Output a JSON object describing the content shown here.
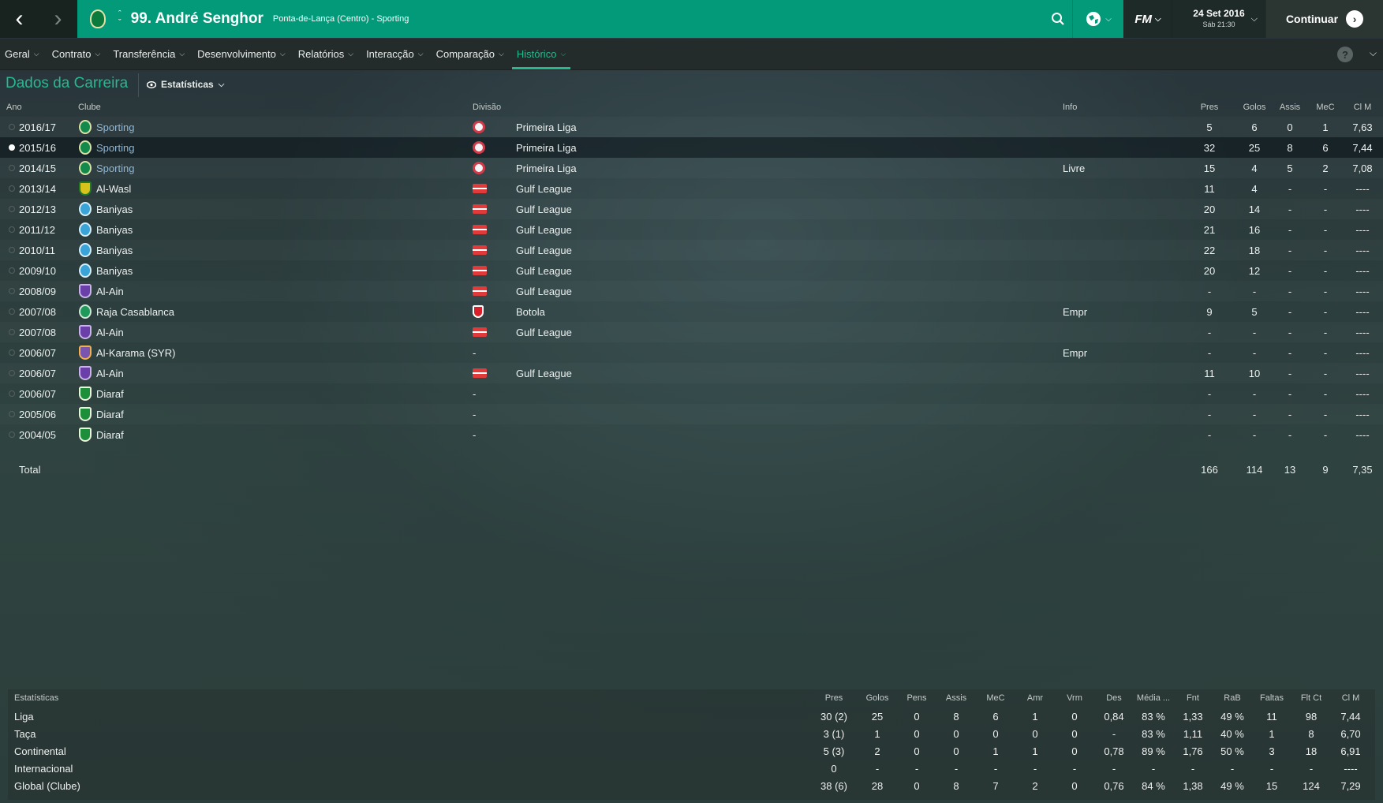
{
  "topbar": {
    "back_icon": "chevron-left-icon",
    "forward_icon": "chevron-right-icon",
    "player_name": "99. André Senghor",
    "player_subtitle": "Ponta-de-Lança (Centro) - Sporting",
    "date": "24 Set 2016",
    "time": "Sáb 21:30",
    "fm_label": "FM",
    "continue_label": "Continuar",
    "accent_color": "#029a79"
  },
  "menu": {
    "items": [
      {
        "label": "Geral"
      },
      {
        "label": "Contrato"
      },
      {
        "label": "Transferência"
      },
      {
        "label": "Desenvolvimento"
      },
      {
        "label": "Relatórios"
      },
      {
        "label": "Interacção"
      },
      {
        "label": "Comparação"
      },
      {
        "label": "Histórico"
      }
    ],
    "active": "Histórico",
    "help_label": "?"
  },
  "section": {
    "title": "Dados da Carreira",
    "view_label": "Estatísticas"
  },
  "career": {
    "headers": {
      "ano": "Ano",
      "clube": "Clube",
      "divisao": "Divisão",
      "info": "Info",
      "pres": "Pres",
      "golos": "Golos",
      "assis": "Assis",
      "mec": "MeC",
      "clm": "Cl M"
    },
    "rows": [
      {
        "ano": "2016/17",
        "clube": "Sporting",
        "divisao": "Primeira Liga",
        "info": "",
        "pres": "5",
        "golos": "6",
        "assis": "0",
        "mec": "1",
        "clm": "7,63"
      },
      {
        "ano": "2015/16",
        "clube": "Sporting",
        "divisao": "Primeira Liga",
        "info": "",
        "pres": "32",
        "golos": "25",
        "assis": "8",
        "mec": "6",
        "clm": "7,44"
      },
      {
        "ano": "2014/15",
        "clube": "Sporting",
        "divisao": "Primeira Liga",
        "info": "Livre",
        "pres": "15",
        "golos": "4",
        "assis": "5",
        "mec": "2",
        "clm": "7,08"
      },
      {
        "ano": "2013/14",
        "clube": "Al-Wasl",
        "divisao": "Gulf League",
        "info": "",
        "pres": "11",
        "golos": "4",
        "assis": "-",
        "mec": "-",
        "clm": "----"
      },
      {
        "ano": "2012/13",
        "clube": "Baniyas",
        "divisao": "Gulf League",
        "info": "",
        "pres": "20",
        "golos": "14",
        "assis": "-",
        "mec": "-",
        "clm": "----"
      },
      {
        "ano": "2011/12",
        "clube": "Baniyas",
        "divisao": "Gulf League",
        "info": "",
        "pres": "21",
        "golos": "16",
        "assis": "-",
        "mec": "-",
        "clm": "----"
      },
      {
        "ano": "2010/11",
        "clube": "Baniyas",
        "divisao": "Gulf League",
        "info": "",
        "pres": "22",
        "golos": "18",
        "assis": "-",
        "mec": "-",
        "clm": "----"
      },
      {
        "ano": "2009/10",
        "clube": "Baniyas",
        "divisao": "Gulf League",
        "info": "",
        "pres": "20",
        "golos": "12",
        "assis": "-",
        "mec": "-",
        "clm": "----"
      },
      {
        "ano": "2008/09",
        "clube": "Al-Ain",
        "divisao": "Gulf League",
        "info": "",
        "pres": "-",
        "golos": "-",
        "assis": "-",
        "mec": "-",
        "clm": "----"
      },
      {
        "ano": "2007/08",
        "clube": "Raja Casablanca",
        "divisao": "Botola",
        "info": "Empr",
        "pres": "9",
        "golos": "5",
        "assis": "-",
        "mec": "-",
        "clm": "----"
      },
      {
        "ano": "2007/08",
        "clube": "Al-Ain",
        "divisao": "Gulf League",
        "info": "",
        "pres": "-",
        "golos": "-",
        "assis": "-",
        "mec": "-",
        "clm": "----"
      },
      {
        "ano": "2006/07",
        "clube": "Al-Karama (SYR)",
        "divisao": "-",
        "info": "Empr",
        "pres": "-",
        "golos": "-",
        "assis": "-",
        "mec": "-",
        "clm": "----"
      },
      {
        "ano": "2006/07",
        "clube": "Al-Ain",
        "divisao": "Gulf League",
        "info": "",
        "pres": "11",
        "golos": "10",
        "assis": "-",
        "mec": "-",
        "clm": "----"
      },
      {
        "ano": "2006/07",
        "clube": "Diaraf",
        "divisao": "-",
        "info": "",
        "pres": "-",
        "golos": "-",
        "assis": "-",
        "mec": "-",
        "clm": "----"
      },
      {
        "ano": "2005/06",
        "clube": "Diaraf",
        "divisao": "-",
        "info": "",
        "pres": "-",
        "golos": "-",
        "assis": "-",
        "mec": "-",
        "clm": "----"
      },
      {
        "ano": "2004/05",
        "clube": "Diaraf",
        "divisao": "-",
        "info": "",
        "pres": "-",
        "golos": "-",
        "assis": "-",
        "mec": "-",
        "clm": "----"
      }
    ],
    "total": {
      "label": "Total",
      "pres": "166",
      "golos": "114",
      "assis": "13",
      "mec": "9",
      "clm": "7,35"
    }
  },
  "stats": {
    "headers": {
      "title": "Estatísticas",
      "pres": "Pres",
      "golos": "Golos",
      "pens": "Pens",
      "assis": "Assis",
      "mec": "MeC",
      "amr": "Amr",
      "vrm": "Vrm",
      "des": "Des",
      "media": "Média ...",
      "fnt": "Fnt",
      "rab": "RaB",
      "faltas": "Faltas",
      "fltct": "Flt Ct",
      "clm": "Cl M"
    },
    "rows": [
      {
        "label": "Liga",
        "pres": "30 (2)",
        "golos": "25",
        "pens": "0",
        "assis": "8",
        "mec": "6",
        "amr": "1",
        "vrm": "0",
        "des": "0,84",
        "media": "83 %",
        "fnt": "1,33",
        "rab": "49 %",
        "faltas": "11",
        "fltct": "98",
        "clm": "7,44"
      },
      {
        "label": "Taça",
        "pres": "3 (1)",
        "golos": "1",
        "pens": "0",
        "assis": "0",
        "mec": "0",
        "amr": "0",
        "vrm": "0",
        "des": "-",
        "media": "83 %",
        "fnt": "1,11",
        "rab": "40 %",
        "faltas": "1",
        "fltct": "8",
        "clm": "6,70"
      },
      {
        "label": "Continental",
        "pres": "5 (3)",
        "golos": "2",
        "pens": "0",
        "assis": "0",
        "mec": "1",
        "amr": "1",
        "vrm": "0",
        "des": "0,78",
        "media": "89 %",
        "fnt": "1,76",
        "rab": "50 %",
        "faltas": "3",
        "fltct": "18",
        "clm": "6,91"
      },
      {
        "label": "Internacional",
        "pres": "0",
        "golos": "-",
        "pens": "-",
        "assis": "-",
        "mec": "-",
        "amr": "-",
        "vrm": "-",
        "des": "-",
        "media": "-",
        "fnt": "-",
        "rab": "-",
        "faltas": "-",
        "fltct": "-",
        "clm": "----"
      },
      {
        "label": "Global (Clube)",
        "pres": "38 (6)",
        "golos": "28",
        "pens": "0",
        "assis": "8",
        "mec": "7",
        "amr": "2",
        "vrm": "0",
        "des": "0,76",
        "media": "84 %",
        "fnt": "1,38",
        "rab": "49 %",
        "faltas": "15",
        "fltct": "124",
        "clm": "7,29"
      }
    ]
  }
}
